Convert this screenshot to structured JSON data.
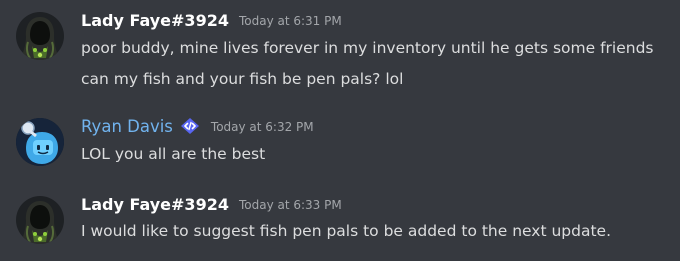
{
  "messages": [
    {
      "author": "Lady Faye#3924",
      "timestamp": "Today at 6:31 PM",
      "avatar_icon": "hooded-figure-avatar-icon",
      "lines": [
        "poor buddy, mine lives forever in my inventory until he gets some friends",
        "can my fish and your fish be pen pals? lol"
      ]
    },
    {
      "author": "Ryan Davis",
      "timestamp": "Today at 6:32 PM",
      "avatar_icon": "robot-face-avatar-icon",
      "badge_icon": "developer-badge-icon",
      "author_color": "#71b3ee",
      "lines": [
        "LOL you all are the best"
      ]
    },
    {
      "author": "Lady Faye#3924",
      "timestamp": "Today at 6:33 PM",
      "avatar_icon": "hooded-figure-avatar-icon",
      "lines": [
        "I would like to suggest fish pen pals to be added to the next update."
      ]
    }
  ],
  "colors": {
    "background": "#36393f",
    "text": "#dcddde",
    "timestamp": "#a3a6aa",
    "username": "#ffffff",
    "badge": "#5865f2"
  }
}
